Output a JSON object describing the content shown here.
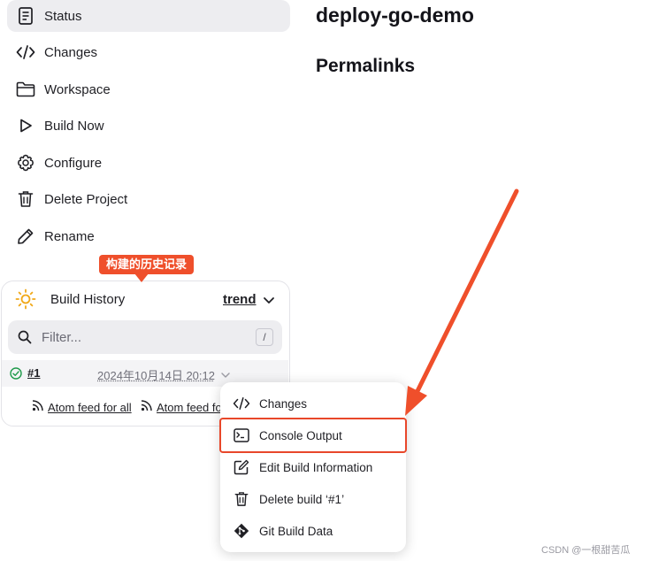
{
  "sidebar": {
    "items": [
      {
        "label": "Status",
        "icon": "document-icon"
      },
      {
        "label": "Changes",
        "icon": "code-icon"
      },
      {
        "label": "Workspace",
        "icon": "folder-icon"
      },
      {
        "label": "Build Now",
        "icon": "play-icon"
      },
      {
        "label": "Configure",
        "icon": "gear-icon"
      },
      {
        "label": "Delete Project",
        "icon": "trash-icon"
      },
      {
        "label": "Rename",
        "icon": "pencil-icon"
      }
    ]
  },
  "main": {
    "title": "deploy-go-demo",
    "permalinks_heading": "Permalinks"
  },
  "annotation": {
    "callout_text": "构建的历史记录",
    "color": "#ef4f2b"
  },
  "build_history": {
    "title": "Build History",
    "trend_label": "trend",
    "filter_placeholder": "Filter...",
    "filter_shortcut": "/",
    "builds": [
      {
        "number": "#1",
        "date": "2024年10月14日 20:12",
        "status": "success"
      }
    ],
    "feed_all": "Atom feed for all",
    "feed_failures": "Atom feed fo"
  },
  "context_menu": {
    "items": [
      {
        "label": "Changes",
        "icon": "code-icon"
      },
      {
        "label": "Console Output",
        "icon": "terminal-icon"
      },
      {
        "label": "Edit Build Information",
        "icon": "edit-icon"
      },
      {
        "label": "Delete build ‘#1’",
        "icon": "trash-icon"
      },
      {
        "label": "Git Build Data",
        "icon": "git-icon"
      }
    ],
    "highlighted": "Console Output"
  },
  "watermark": "CSDN @一根甜苦瓜"
}
